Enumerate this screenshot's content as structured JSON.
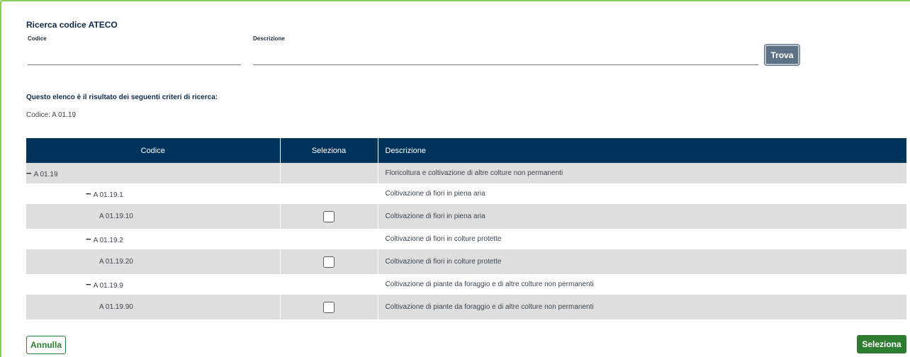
{
  "search": {
    "title": "Ricerca codice ATECO",
    "codice_label": "Codice",
    "codice_value": "",
    "descrizione_label": "Descrizione",
    "descrizione_value": "",
    "trova_label": "Trova"
  },
  "criteria": {
    "heading": "Questo elenco è il risultato dei seguenti criteri di ricerca:",
    "value": "Codice: A 01.19"
  },
  "table": {
    "headers": [
      "Codice",
      "Seleziona",
      "Descrizione"
    ],
    "rows": [
      {
        "code": "A 01.19",
        "level": 0,
        "collapsible": true,
        "selectable": false,
        "description": "Floricoltura e coltivazione di altre colture non permanenti"
      },
      {
        "code": "A 01.19.1",
        "level": 1,
        "collapsible": true,
        "selectable": false,
        "description": "Coltivazione di fiori in piena aria"
      },
      {
        "code": "A 01.19.10",
        "level": 2,
        "collapsible": false,
        "selectable": true,
        "description": "Coltivazione di fiori in piena aria"
      },
      {
        "code": "A 01.19.2",
        "level": 1,
        "collapsible": true,
        "selectable": false,
        "description": "Coltivazione di fiori in colture protette"
      },
      {
        "code": "A 01.19.20",
        "level": 2,
        "collapsible": false,
        "selectable": true,
        "description": "Coltivazione di fiori in colture protette"
      },
      {
        "code": "A 01.19.9",
        "level": 1,
        "collapsible": true,
        "selectable": false,
        "description": "Coltivazione di piante da foraggio e di altre colture non permanenti"
      },
      {
        "code": "A 01.19.90",
        "level": 2,
        "collapsible": false,
        "selectable": true,
        "description": "Coltivazione di piante da foraggio e di altre colture non permanenti"
      }
    ]
  },
  "footer": {
    "annulla_label": "Annulla",
    "seleziona_label": "Seleziona"
  },
  "icons": {
    "collapse": "minus-icon",
    "checkbox": "checkbox-icon"
  },
  "colors": {
    "header_bg": "#01345a",
    "primary_green": "#2e7d32",
    "trova_bg": "#5f7285",
    "row_shade": "#dedede",
    "frame_border": "#8ccd5a"
  }
}
